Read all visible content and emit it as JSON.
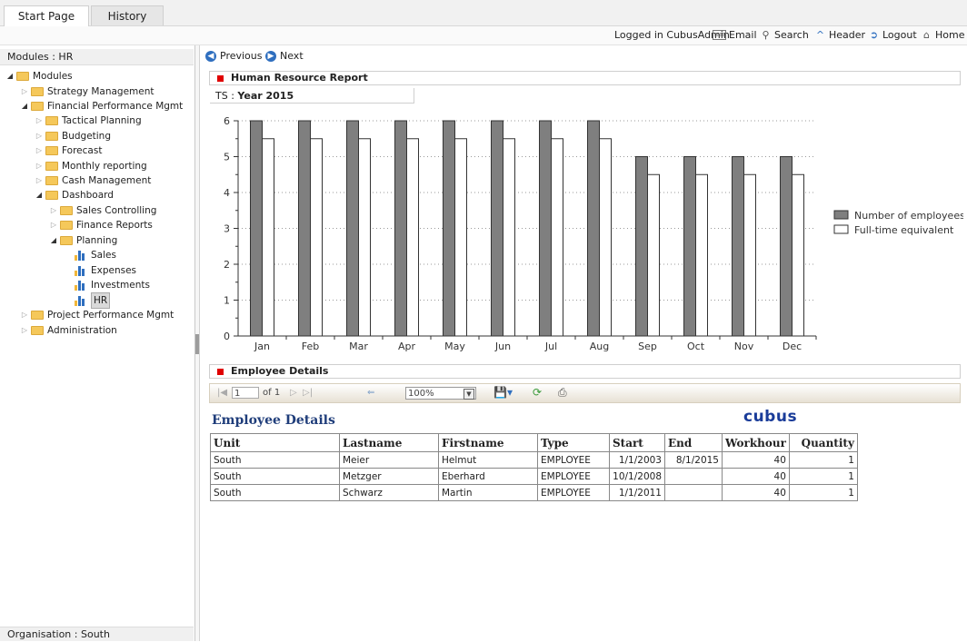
{
  "tabs": [
    {
      "label": "Start Page"
    },
    {
      "label": "History"
    }
  ],
  "topbar": {
    "logged_in": "Logged in CubusAdmin",
    "email": "Email",
    "search": "Search",
    "header": "Header",
    "logout": "Logout",
    "home": "Home"
  },
  "left": {
    "title": "Modules : HR",
    "footer": "Organisation : South",
    "tree": [
      {
        "label": "Modules"
      },
      {
        "label": "Strategy Management"
      },
      {
        "label": "Financial Performance Mgmt"
      },
      {
        "label": "Tactical Planning"
      },
      {
        "label": "Budgeting"
      },
      {
        "label": "Forecast"
      },
      {
        "label": "Monthly reporting"
      },
      {
        "label": "Cash Management"
      },
      {
        "label": "Dashboard"
      },
      {
        "label": "Sales Controlling"
      },
      {
        "label": "Finance Reports"
      },
      {
        "label": "Planning"
      },
      {
        "label": "Sales"
      },
      {
        "label": "Expenses"
      },
      {
        "label": "Investments"
      },
      {
        "label": "HR"
      },
      {
        "label": "Project Performance Mgmt"
      },
      {
        "label": "Administration"
      }
    ]
  },
  "nav": {
    "previous": "Previous",
    "next": "Next"
  },
  "section1": {
    "title": "Human Resource Report"
  },
  "ts": {
    "label": "TS :",
    "value": "Year 2015"
  },
  "chart_data": {
    "type": "bar",
    "categories": [
      "Jan",
      "Feb",
      "Mar",
      "Apr",
      "May",
      "Jun",
      "Jul",
      "Aug",
      "Sep",
      "Oct",
      "Nov",
      "Dec"
    ],
    "series": [
      {
        "name": "Number of employees",
        "values": [
          6,
          6,
          6,
          6,
          6,
          6,
          6,
          6,
          5,
          5,
          5,
          5
        ],
        "color": "#7f7f7f"
      },
      {
        "name": "Full-time equivalent",
        "values": [
          5.5,
          5.5,
          5.5,
          5.5,
          5.5,
          5.5,
          5.5,
          5.5,
          4.5,
          4.5,
          4.5,
          4.5
        ],
        "color": "#ffffff"
      }
    ],
    "yticks": [
      0,
      1,
      2,
      3,
      4,
      5,
      6
    ],
    "ylim": [
      0,
      6
    ],
    "grid": "dotted horizontal",
    "legend": "right"
  },
  "section2": {
    "title": "Employee Details"
  },
  "rtoolbar": {
    "page": "1",
    "of": "of 1",
    "zoom": "100%"
  },
  "report": {
    "title": "Employee Details",
    "logo_text": "cubus",
    "columns": [
      "Unit",
      "Lastname",
      "Firstname",
      "Type",
      "Start",
      "End",
      "Workhour",
      "Quantity"
    ],
    "rows": [
      [
        "South",
        "Meier",
        "Helmut",
        "EMPLOYEE",
        "1/1/2003",
        "8/1/2015",
        "40",
        "1"
      ],
      [
        "South",
        "Metzger",
        "Eberhard",
        "EMPLOYEE",
        "10/1/2008",
        "",
        "40",
        "1"
      ],
      [
        "South",
        "Schwarz",
        "Martin",
        "EMPLOYEE",
        "1/1/2011",
        "",
        "40",
        "1"
      ]
    ]
  },
  "colors": {
    "accent": "#2f6fbf",
    "marker": "#e00000",
    "bar_dark": "#7f7f7f"
  }
}
